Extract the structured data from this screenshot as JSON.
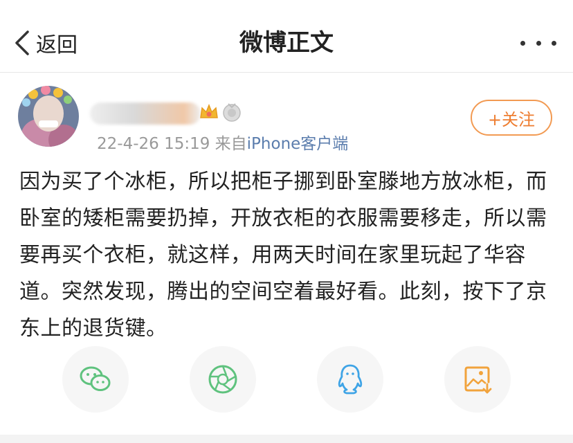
{
  "nav": {
    "back_label": "返回",
    "title": "微博正文"
  },
  "post": {
    "timestamp": "22-4-26 15:19",
    "source_prefix": "来自",
    "source": "iPhone客户端",
    "follow_label": "+关注",
    "text": "因为买了个冰柜，所以把柜子挪到卧室滕地方放冰柜，而卧室的矮柜需要扔掉，开放衣柜的衣服需要移走，所以需要再买个衣柜，就这样，用两天时间在家里玩起了华容道。突然发现，腾出的空间空着最好看。此刻，按下了京东上的退货键。"
  },
  "share": [
    {
      "icon": "wechat-icon",
      "color": "#5fc27e"
    },
    {
      "icon": "moments-icon",
      "color": "#5fc27e"
    },
    {
      "icon": "qq-icon",
      "color": "#3fa4e6"
    },
    {
      "icon": "save-image-icon",
      "color": "#f1a33c"
    }
  ],
  "colors": {
    "accent": "#ee7d30",
    "link": "#5b7dad",
    "muted": "#999999"
  }
}
